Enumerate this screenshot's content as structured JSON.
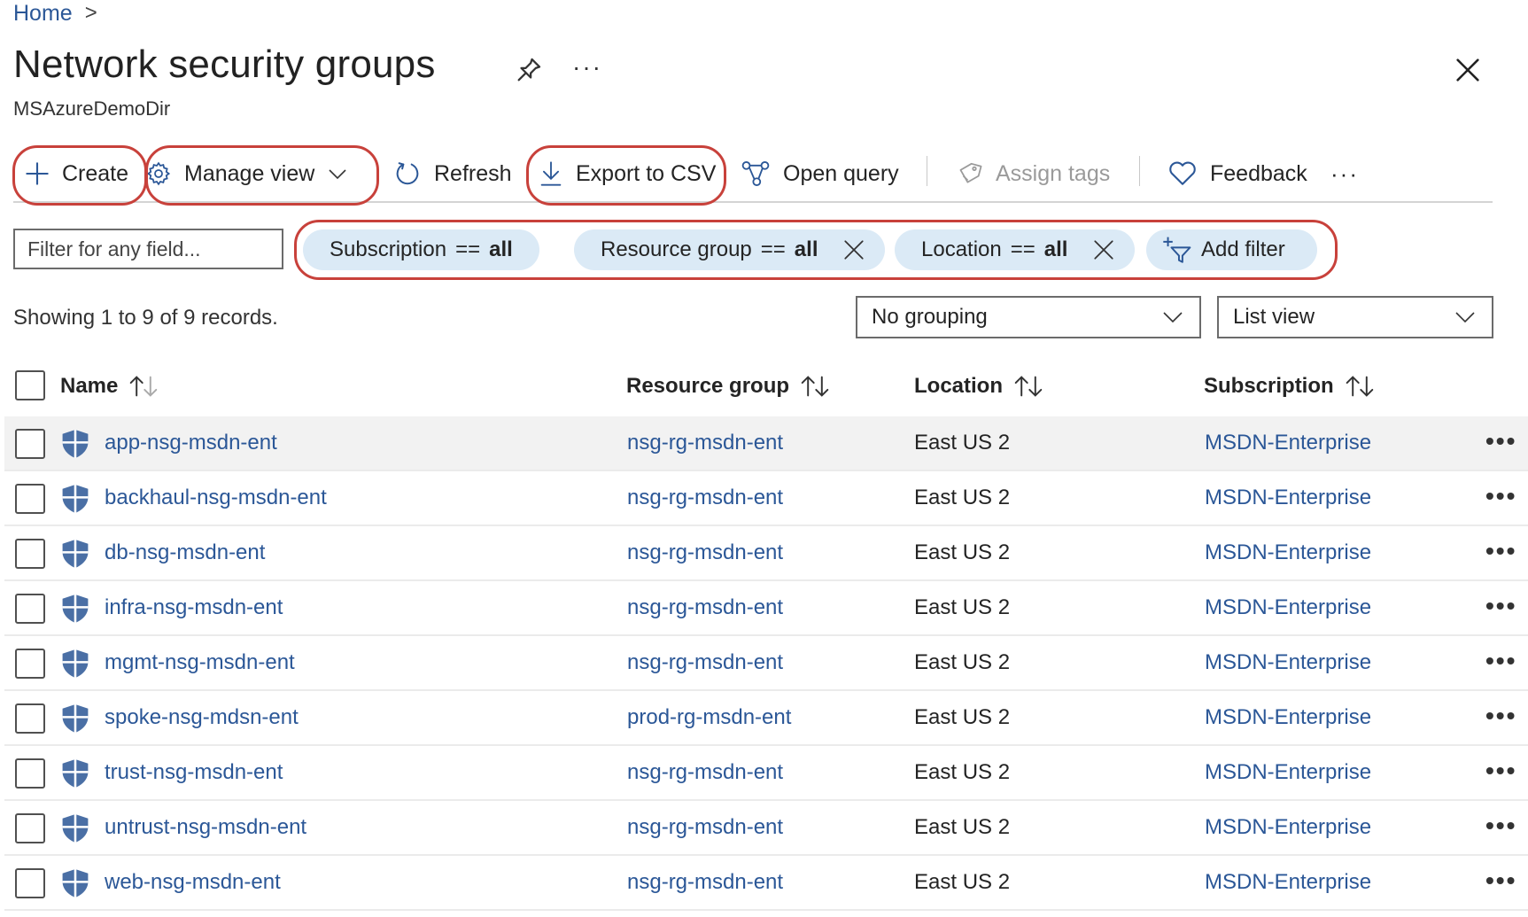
{
  "breadcrumb": {
    "home": "Home",
    "separator": ">"
  },
  "header": {
    "title": "Network security groups",
    "subtitle": "MSAzureDemoDir",
    "more": "···"
  },
  "toolbar": {
    "create": "Create",
    "manage_view": "Manage view",
    "refresh": "Refresh",
    "export_csv": "Export to CSV",
    "open_query": "Open query",
    "assign_tags": "Assign tags",
    "feedback": "Feedback",
    "more": "···"
  },
  "filters": {
    "placeholder": "Filter for any field...",
    "pills": [
      {
        "field": "Subscription",
        "op": "==",
        "value": "all"
      },
      {
        "field": "Resource group",
        "op": "==",
        "value": "all"
      },
      {
        "field": "Location",
        "op": "==",
        "value": "all"
      }
    ],
    "add_filter": "Add filter"
  },
  "summary": {
    "showing": "Showing 1 to 9 of 9 records."
  },
  "grouping_select": {
    "value": "No grouping"
  },
  "view_select": {
    "value": "List view"
  },
  "table": {
    "columns": {
      "name": "Name",
      "resource_group": "Resource group",
      "location": "Location",
      "subscription": "Subscription"
    },
    "rows": [
      {
        "name": "app-nsg-msdn-ent",
        "resource_group": "nsg-rg-msdn-ent",
        "location": "East US 2",
        "subscription": "MSDN-Enterprise"
      },
      {
        "name": "backhaul-nsg-msdn-ent",
        "resource_group": "nsg-rg-msdn-ent",
        "location": "East US 2",
        "subscription": "MSDN-Enterprise"
      },
      {
        "name": "db-nsg-msdn-ent",
        "resource_group": "nsg-rg-msdn-ent",
        "location": "East US 2",
        "subscription": "MSDN-Enterprise"
      },
      {
        "name": "infra-nsg-msdn-ent",
        "resource_group": "nsg-rg-msdn-ent",
        "location": "East US 2",
        "subscription": "MSDN-Enterprise"
      },
      {
        "name": "mgmt-nsg-msdn-ent",
        "resource_group": "nsg-rg-msdn-ent",
        "location": "East US 2",
        "subscription": "MSDN-Enterprise"
      },
      {
        "name": "spoke-nsg-mdsn-ent",
        "resource_group": "prod-rg-msdn-ent",
        "location": "East US 2",
        "subscription": "MSDN-Enterprise"
      },
      {
        "name": "trust-nsg-msdn-ent",
        "resource_group": "nsg-rg-msdn-ent",
        "location": "East US 2",
        "subscription": "MSDN-Enterprise"
      },
      {
        "name": "untrust-nsg-msdn-ent",
        "resource_group": "nsg-rg-msdn-ent",
        "location": "East US 2",
        "subscription": "MSDN-Enterprise"
      },
      {
        "name": "web-nsg-msdn-ent",
        "resource_group": "nsg-rg-msdn-ent",
        "location": "East US 2",
        "subscription": "MSDN-Enterprise"
      }
    ],
    "row_more": "•••"
  },
  "colors": {
    "link": "#2b5797",
    "highlight": "#c8413b",
    "pill_bg": "#dbeaf6",
    "row_hover": "#f2f2f2",
    "shield": "#4a6fa5"
  },
  "icons": {
    "pin": "pin-icon",
    "close": "close-icon",
    "create": "plus-icon",
    "manage_view": "gear-icon",
    "refresh": "refresh-icon",
    "export": "download-icon",
    "open_query": "query-icon",
    "assign_tags": "tag-icon",
    "feedback": "heart-icon",
    "add_filter": "add-filter-icon",
    "row": "shield-icon"
  }
}
